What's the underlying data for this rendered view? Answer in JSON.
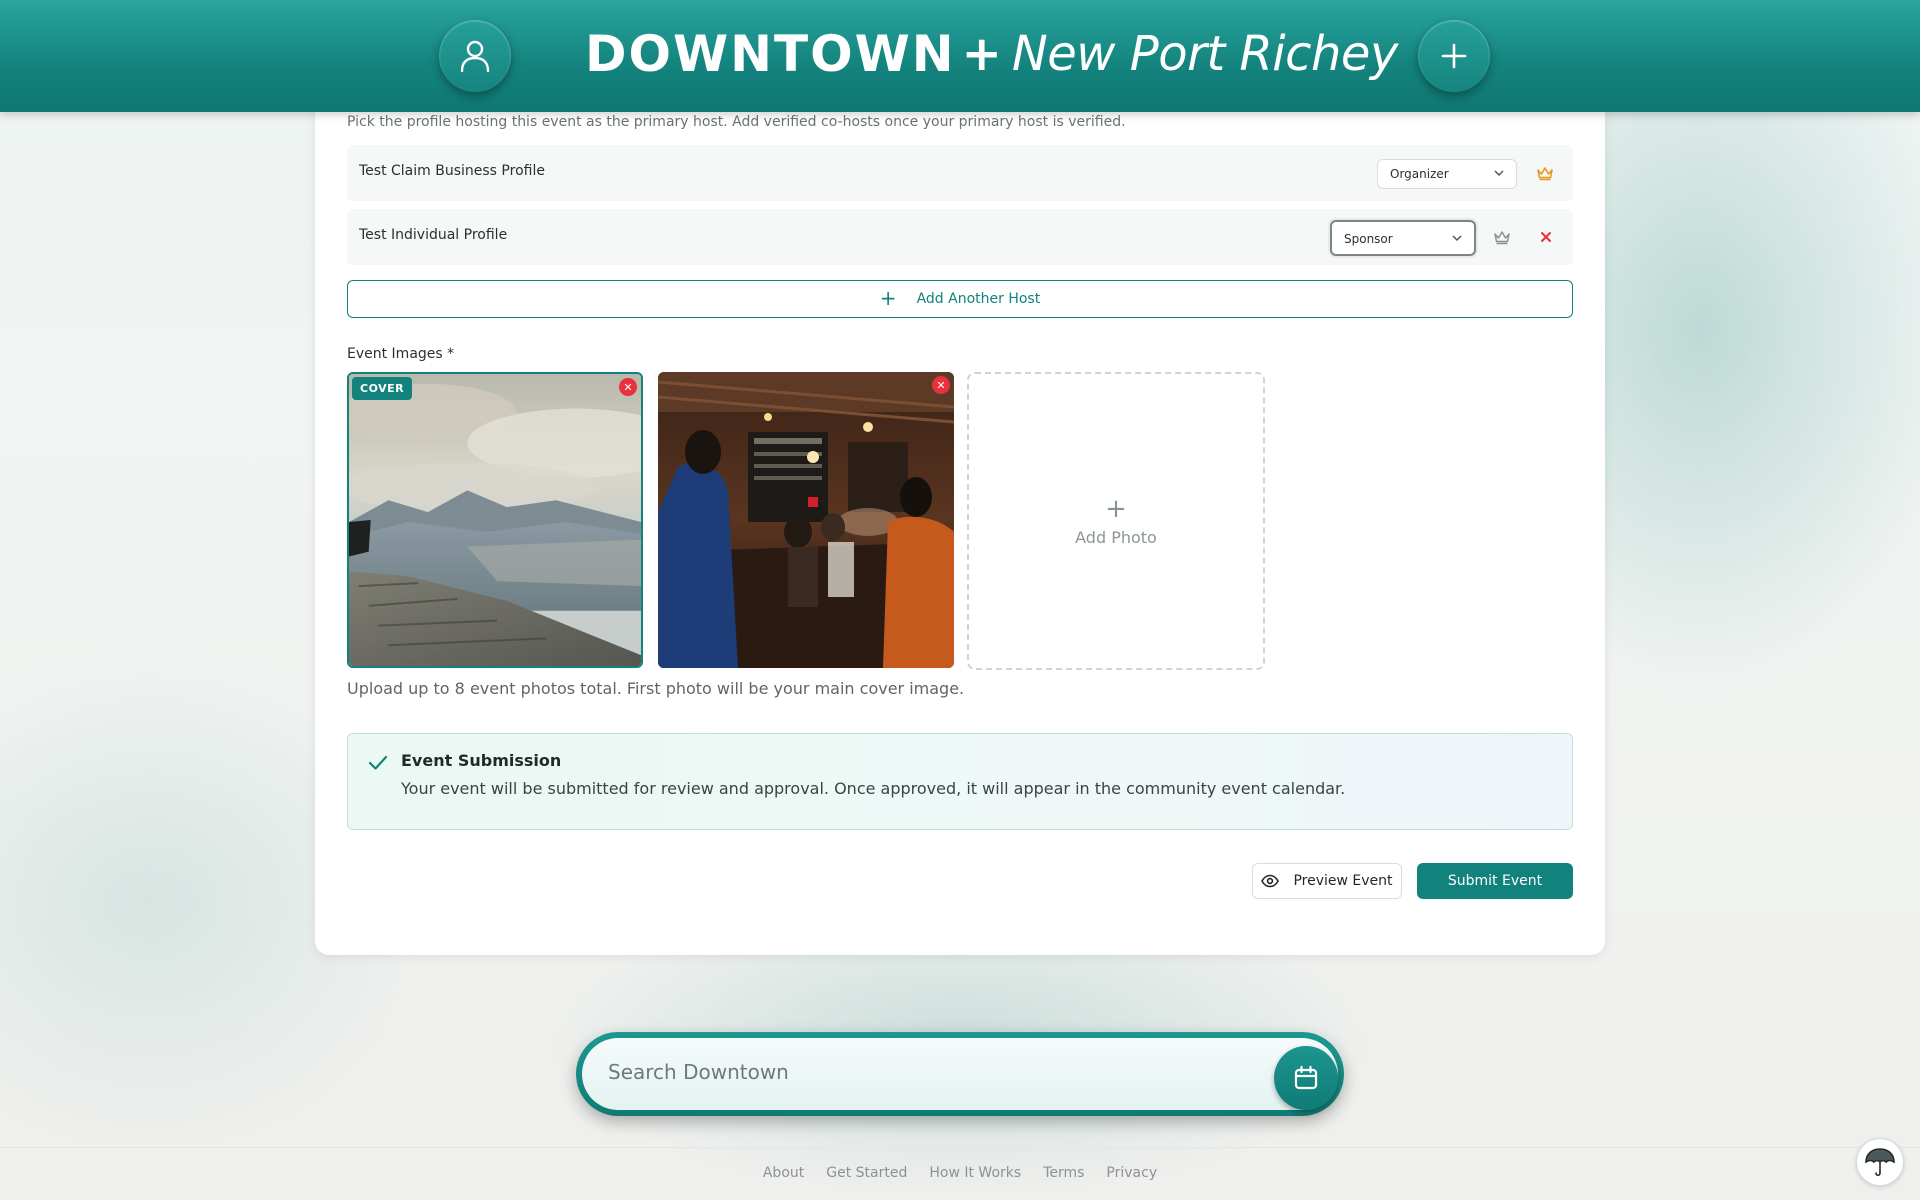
{
  "header": {
    "brand_main": "DOWNTOWN",
    "brand_plus": "+",
    "brand_city": "New Port Richey",
    "profile_icon": "user-icon",
    "create_icon": "plus-icon"
  },
  "hosts": {
    "help_text": "Pick the profile hosting this event as the primary host. Add verified co-hosts once your primary host is verified.",
    "rows": [
      {
        "name": "Test Claim Business Profile",
        "role": "Organizer",
        "crown_color": "#e59a1a"
      },
      {
        "name": "Test Individual Profile",
        "role": "Sponsor",
        "crown_color": "#8a9494"
      }
    ],
    "add_label": "Add Another Host"
  },
  "images": {
    "label": "Event Images *",
    "cover_badge": "COVER",
    "add_photo_label": "Add Photo",
    "note": "Upload up to 8 event photos total. First photo will be your main cover image."
  },
  "notice": {
    "title": "Event Submission",
    "body": "Your event will be submitted for review and approval. Once approved, it will appear in the community event calendar."
  },
  "actions": {
    "preview_label": "Preview Event",
    "submit_label": "Submit Event"
  },
  "search": {
    "placeholder": "Search Downtown"
  },
  "footer": {
    "links": [
      "About",
      "Get Started",
      "How It Works",
      "Terms",
      "Privacy"
    ]
  },
  "colors": {
    "brand": "#12827c",
    "danger": "#e8313c",
    "crown_primary": "#e59a1a"
  }
}
